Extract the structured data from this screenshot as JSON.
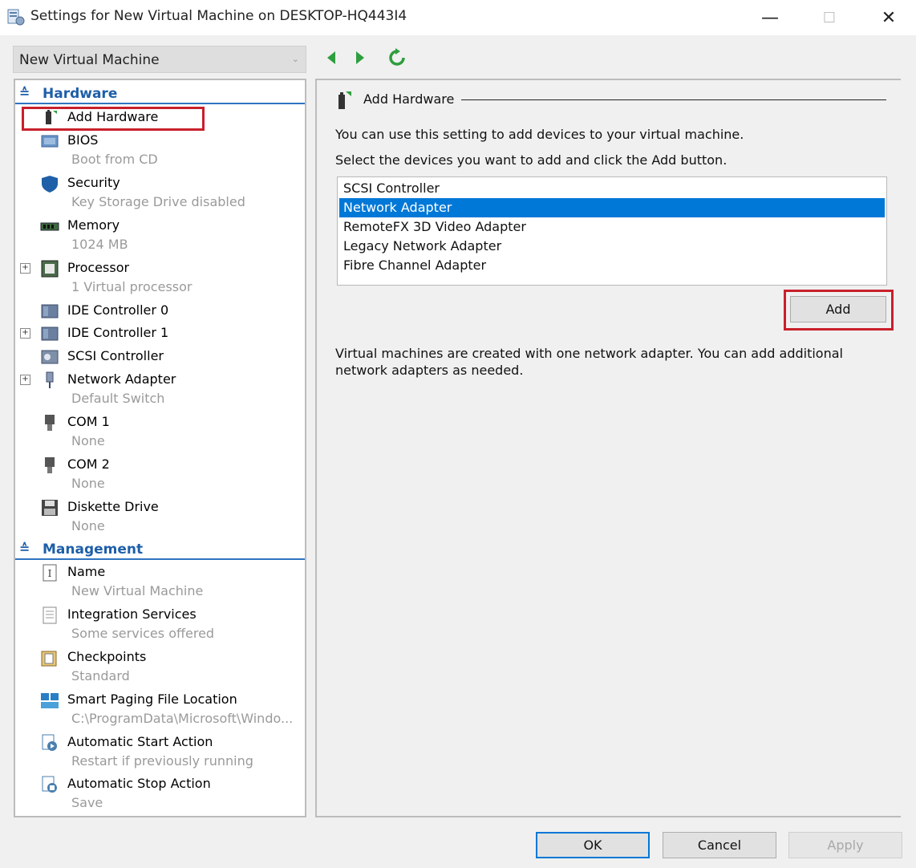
{
  "window": {
    "title": "Settings for New Virtual Machine on DESKTOP-HQ443I4",
    "minimize": "—",
    "maximize": "☐",
    "close": "✕"
  },
  "vm_selector": {
    "value": "New Virtual Machine",
    "arrow": "⌄"
  },
  "tree": {
    "hardware_header": "Hardware",
    "management_header": "Management",
    "hardware": [
      {
        "label": "Add Hardware",
        "sub": "",
        "icon": "add-hardware-icon"
      },
      {
        "label": "BIOS",
        "sub": "Boot from CD",
        "icon": "bios-icon"
      },
      {
        "label": "Security",
        "sub": "Key Storage Drive disabled",
        "icon": "shield-icon"
      },
      {
        "label": "Memory",
        "sub": "1024 MB",
        "icon": "memory-icon"
      },
      {
        "label": "Processor",
        "sub": "1 Virtual processor",
        "icon": "processor-icon"
      },
      {
        "label": "IDE Controller 0",
        "sub": "",
        "icon": "ide-controller-icon"
      },
      {
        "label": "IDE Controller 1",
        "sub": "",
        "icon": "ide-controller-icon"
      },
      {
        "label": "SCSI Controller",
        "sub": "",
        "icon": "scsi-controller-icon"
      },
      {
        "label": "Network Adapter",
        "sub": "Default Switch",
        "icon": "network-adapter-icon"
      },
      {
        "label": "COM 1",
        "sub": "None",
        "icon": "com-port-icon"
      },
      {
        "label": "COM 2",
        "sub": "None",
        "icon": "com-port-icon"
      },
      {
        "label": "Diskette Drive",
        "sub": "None",
        "icon": "diskette-icon"
      }
    ],
    "management": [
      {
        "label": "Name",
        "sub": "New Virtual Machine",
        "icon": "name-icon"
      },
      {
        "label": "Integration Services",
        "sub": "Some services offered",
        "icon": "integration-services-icon"
      },
      {
        "label": "Checkpoints",
        "sub": "Standard",
        "icon": "checkpoints-icon"
      },
      {
        "label": "Smart Paging File Location",
        "sub": "C:\\ProgramData\\Microsoft\\Windo...",
        "icon": "smart-paging-icon"
      },
      {
        "label": "Automatic Start Action",
        "sub": "Restart if previously running",
        "icon": "auto-start-icon"
      },
      {
        "label": "Automatic Stop Action",
        "sub": "Save",
        "icon": "auto-stop-icon"
      }
    ]
  },
  "panel": {
    "title": "Add Hardware",
    "desc1": "You can use this setting to add devices to your virtual machine.",
    "desc2": "Select the devices you want to add and click the Add button.",
    "devices": [
      "SCSI Controller",
      "Network Adapter",
      "RemoteFX 3D Video Adapter",
      "Legacy Network Adapter",
      "Fibre Channel Adapter"
    ],
    "selected_device": "Network Adapter",
    "add_button": "Add",
    "note": "Virtual machines are created with one network adapter. You can add additional network adapters as needed."
  },
  "footer": {
    "ok": "OK",
    "cancel": "Cancel",
    "apply": "Apply"
  },
  "colors": {
    "accent": "#0078d7",
    "header_blue": "#1e5fa8",
    "highlight_red": "#c8202c",
    "nav_green": "#2e9e3e"
  }
}
